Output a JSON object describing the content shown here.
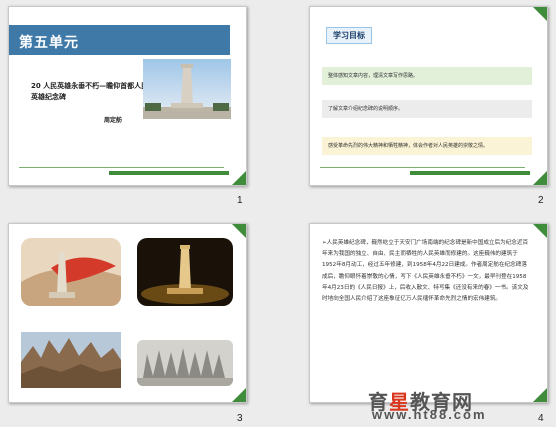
{
  "slides": [
    {
      "number": "1",
      "unit_title": "第五单元",
      "lesson_title": "20 人民英雄永垂不朽—瞻仰首都人民英雄纪念碑",
      "author": "周定舫"
    },
    {
      "number": "2",
      "objectives_title": "学习目标",
      "objectives": [
        "整体感知文章内容，理清文章写作思路。",
        "了解文章介绍纪念碑的说明顺序。",
        "感受革命先烈的伟大精神和牺牲精神，体会作者对人民英雄的崇敬之情。"
      ]
    },
    {
      "number": "3"
    },
    {
      "number": "4",
      "body": "➢人民英雄纪念碑，巍然屹立于天安门广场南端的纪念碑是新中国成立后为纪念近百年来为我国的独立、自由、民主而牺牲的人民英雄而修建的。这座巍伟的建筑于1952年8月动工，经过五年修建，到1958年4月22日建成。作者周定舫在纪念碑落成后，瞻仰眼怀着崇敬的心情，写下《人民英雄永垂不朽》一文，最早刊登在1958年4月23日的《人民日报》上，后收入散文、特写集《还没有来的春》一书。该文及时地向全国人民介绍了这座象征亿万人民缅怀革命先烈之情的宏伟建筑。"
    }
  ],
  "watermark": {
    "part1": "育",
    "part2": "星",
    "part3": "教育网",
    "url": "www.ht88.com"
  },
  "colors": {
    "accent_green": "#3f8c3a",
    "header_blue": "#3f79a8"
  }
}
